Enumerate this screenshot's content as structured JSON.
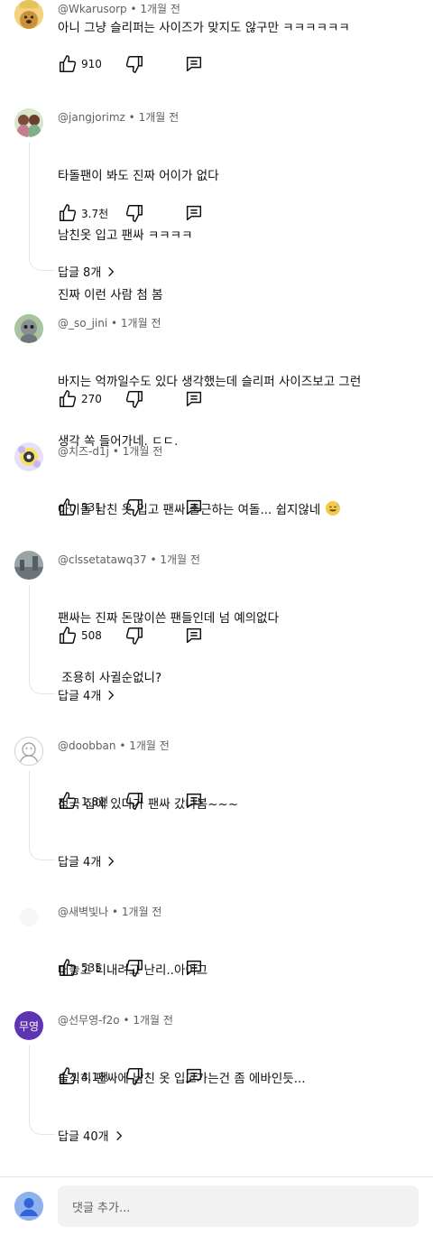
{
  "comments": [
    {
      "author": "@Wkarusorp",
      "time": "1개월 전",
      "lines": [
        "아니 그냥 슬리퍼는 사이즈가 맞지도 않구만 ㅋㅋㅋㅋㅋㅋ"
      ],
      "likes": "910",
      "replies": null
    },
    {
      "author": "@jangjorimz",
      "time": "1개월 전",
      "lines": [
        "타돌팬이 봐도 진짜 어이가 없다",
        "남친옷 입고 팬싸 ㅋㅋㅋㅋ",
        "진짜 이런 사람 첨 봄"
      ],
      "likes": "3.7천",
      "replies": "답글 8개"
    },
    {
      "author": "@_so_jini",
      "time": "1개월 전",
      "lines": [
        "바지는 억까일수도 있다 생각했는데 슬리퍼 사이즈보고 그런",
        "생각 쏙 들어가네. ㄷㄷ."
      ],
      "likes": "270",
      "replies": null
    },
    {
      "author": "@치즈-d1j",
      "time": "1개월 전",
      "lines": [
        "아이돌 남친 옷 입고 팬싸 출근하는 여돌... 쉽지않네"
      ],
      "likes": "331",
      "replies": null
    },
    {
      "author": "@clssetatawq37",
      "time": "1개월 전",
      "lines": [
        "팬싸는 진짜 돈많이쓴 팬들인데 넘 예의없다",
        " 조용히 사귈순없니?"
      ],
      "likes": "508",
      "replies": "답글 4개"
    },
    {
      "author": "@doobban",
      "time": "1개월 전",
      "lines": [
        "정국 집에 있다가 팬싸 갔나봄~~~"
      ],
      "likes": "1.8천",
      "replies": "답글 4개"
    },
    {
      "author": "@새벽빛나",
      "time": "1개월 전",
      "lines": [
        "대놓고 티내려고 난리..아이그"
      ],
      "likes": "535",
      "replies": null
    },
    {
      "author": "@선무영-f2o",
      "time": "1개월 전",
      "avatar_text": "무영",
      "lines": [
        "솔직히 팬싸에 남친 옷 입고가는건 좀 에바인듯..."
      ],
      "likes": "4.1천",
      "replies": "답글 40개"
    }
  ],
  "footer": {
    "placeholder": "댓글 추가..."
  },
  "colors": {
    "meta": "#606060",
    "avatar_purple": "#5e35b1",
    "input_bg": "#f2f2f2"
  },
  "icons": [
    "like-icon",
    "dislike-icon",
    "reply-icon",
    "chevron-right-icon",
    "emoji-sweat-smile-icon"
  ]
}
